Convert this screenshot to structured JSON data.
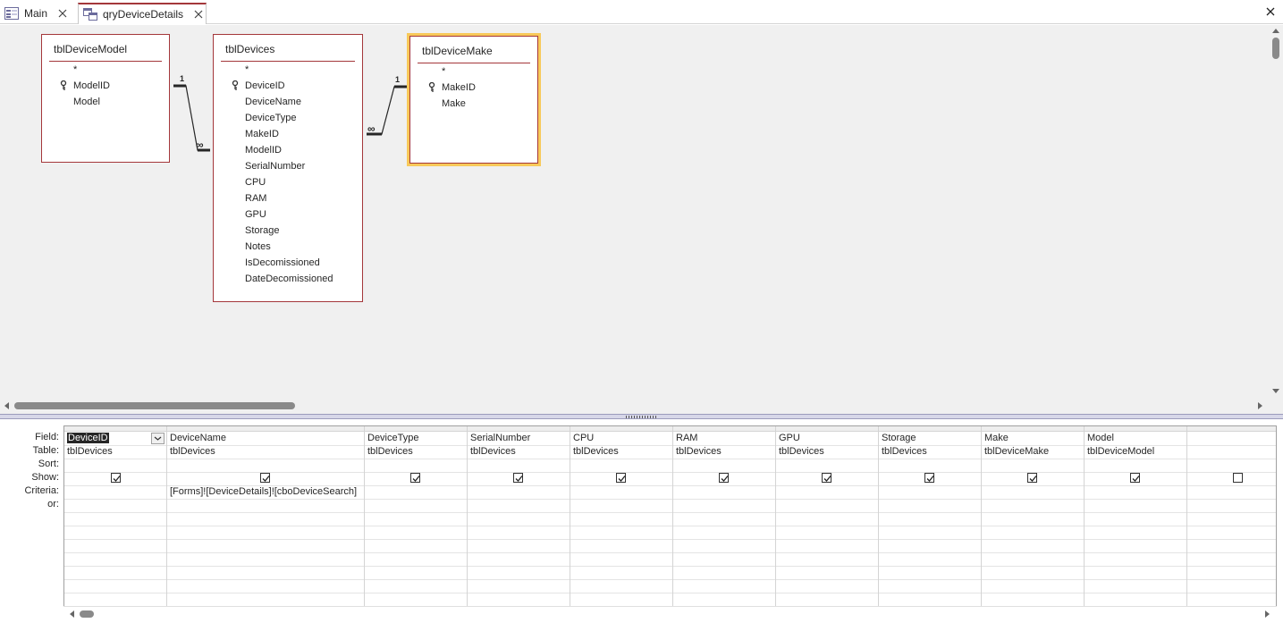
{
  "tabs": [
    {
      "label": "Main",
      "icon": "form-icon",
      "active": false
    },
    {
      "label": "qryDeviceDetails",
      "icon": "query-icon",
      "active": true
    }
  ],
  "tables": [
    {
      "name": "tblDeviceModel",
      "fields": [
        "*",
        "ModelID",
        "Model"
      ],
      "key_field": "ModelID"
    },
    {
      "name": "tblDevices",
      "fields": [
        "*",
        "DeviceID",
        "DeviceName",
        "DeviceType",
        "MakeID",
        "ModelID",
        "SerialNumber",
        "CPU",
        "RAM",
        "GPU",
        "Storage",
        "Notes",
        "IsDecomissioned",
        "DateDecomissioned"
      ],
      "key_field": "DeviceID"
    },
    {
      "name": "tblDeviceMake",
      "fields": [
        "*",
        "MakeID",
        "Make"
      ],
      "key_field": "MakeID",
      "selected": true
    }
  ],
  "relationships": [
    {
      "from": "tblDeviceModel.ModelID",
      "to": "tblDevices.ModelID",
      "one_label": "1",
      "many_label": "∞"
    },
    {
      "from": "tblDeviceMake.MakeID",
      "to": "tblDevices.MakeID",
      "one_label": "1",
      "many_label": "∞"
    }
  ],
  "grid": {
    "row_labels": {
      "field": "Field:",
      "table": "Table:",
      "sort": "Sort:",
      "show": "Show:",
      "criteria": "Criteria:",
      "or": "or:"
    },
    "columns": [
      {
        "field": "DeviceID",
        "table": "tblDevices",
        "show": true,
        "criteria": ""
      },
      {
        "field": "DeviceName",
        "table": "tblDevices",
        "show": true,
        "criteria": "[Forms]![DeviceDetails]![cboDeviceSearch]"
      },
      {
        "field": "DeviceType",
        "table": "tblDevices",
        "show": true,
        "criteria": ""
      },
      {
        "field": "SerialNumber",
        "table": "tblDevices",
        "show": true,
        "criteria": ""
      },
      {
        "field": "CPU",
        "table": "tblDevices",
        "show": true,
        "criteria": ""
      },
      {
        "field": "RAM",
        "table": "tblDevices",
        "show": true,
        "criteria": ""
      },
      {
        "field": "GPU",
        "table": "tblDevices",
        "show": true,
        "criteria": ""
      },
      {
        "field": "Storage",
        "table": "tblDevices",
        "show": true,
        "criteria": ""
      },
      {
        "field": "Make",
        "table": "tblDeviceMake",
        "show": true,
        "criteria": ""
      },
      {
        "field": "Model",
        "table": "tblDeviceModel",
        "show": true,
        "criteria": ""
      },
      {
        "field": "",
        "table": "",
        "show": false,
        "criteria": ""
      }
    ]
  },
  "colors": {
    "accent": "#a4373a",
    "selection": "#f8c95a",
    "surface": "#f0f0f0"
  }
}
